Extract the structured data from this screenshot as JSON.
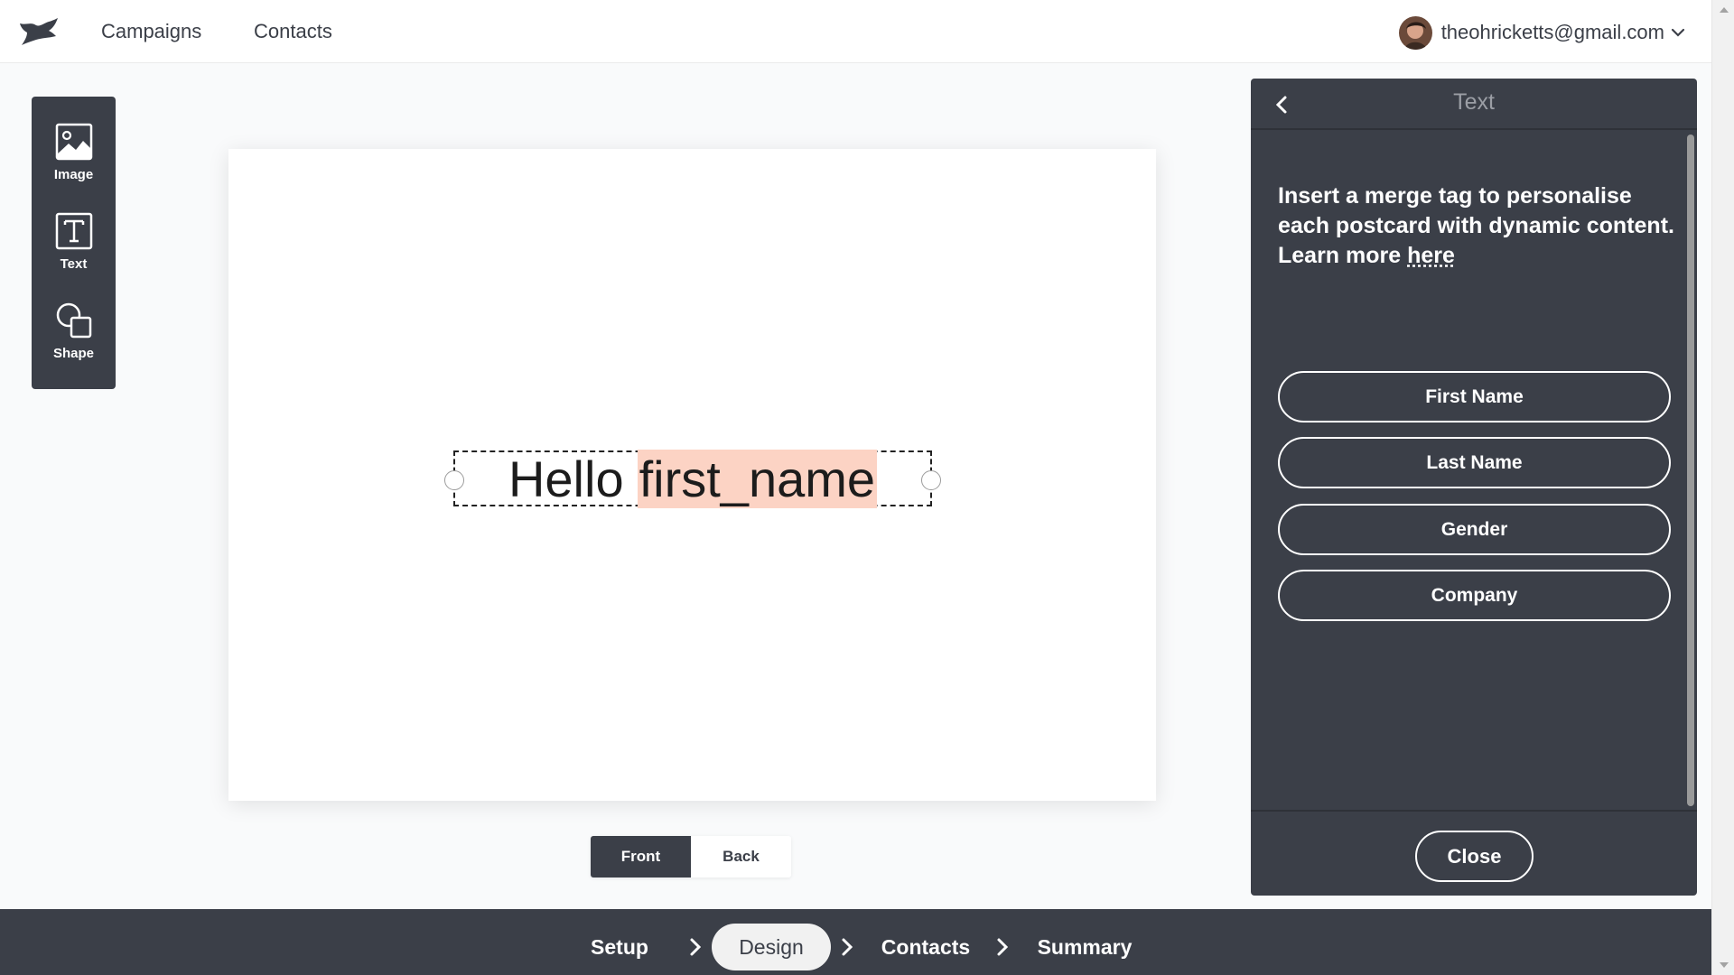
{
  "topbar": {
    "nav": [
      {
        "label": "Campaigns"
      },
      {
        "label": "Contacts"
      }
    ],
    "user": {
      "email": "theohricketts@gmail.com"
    }
  },
  "tools": [
    {
      "label": "Image",
      "icon": "image-icon"
    },
    {
      "label": "Text",
      "icon": "text-icon"
    },
    {
      "label": "Shape",
      "icon": "shape-icon"
    }
  ],
  "canvas": {
    "text_static": "Hello",
    "merge_tag": "first_name"
  },
  "side_toggle": {
    "front": "Front",
    "back": "Back",
    "active": "Front"
  },
  "panel": {
    "title": "Text",
    "description": "Insert a merge tag to personalise each postcard with dynamic content. Learn more",
    "link_text": "here",
    "merge_buttons": [
      "First Name",
      "Last Name",
      "Gender",
      "Company"
    ],
    "close_label": "Close"
  },
  "stepper": {
    "steps": [
      "Setup",
      "Design",
      "Contacts",
      "Summary"
    ],
    "active": "Design"
  },
  "colors": {
    "dark": "#3b3f48",
    "merge_highlight": "#fcd3c4",
    "background": "#f9fafb"
  }
}
